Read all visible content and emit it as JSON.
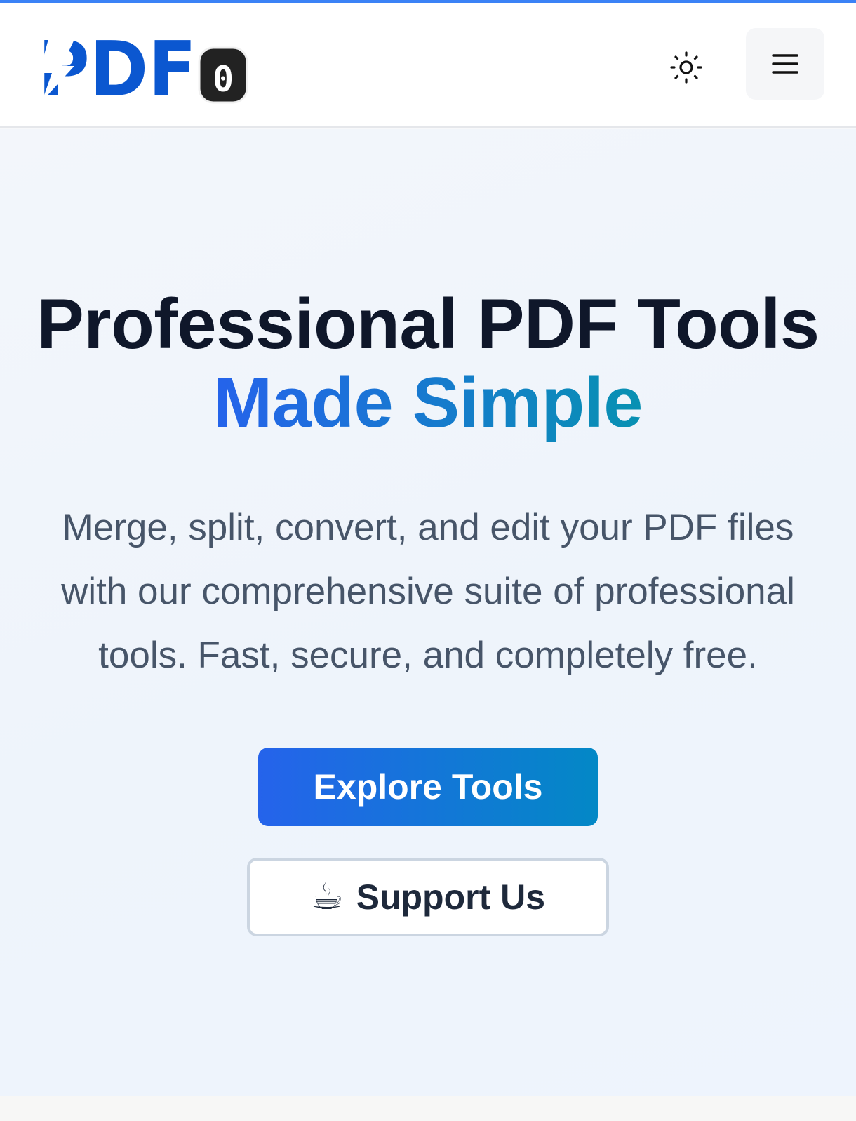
{
  "header": {
    "logo": {
      "text": "PDF",
      "badge": "0",
      "color": "#0b57d0"
    },
    "theme_toggle_icon": "sun-icon",
    "menu_icon": "hamburger-menu-icon"
  },
  "hero": {
    "title_line1": "Professional PDF Tools",
    "title_line2": "Made Simple",
    "description_lines": [
      "Merge, split, convert, and edit your PDF files",
      "with our comprehensive suite of professional",
      "tools. Fast, secure, and completely free."
    ],
    "primary_button": {
      "label": "Explore Tools"
    },
    "secondary_button": {
      "icon": "☕",
      "label": "Support Us"
    }
  },
  "colors": {
    "accent": "#3b82f6",
    "gradient_start": "#2563eb",
    "gradient_end": "#0891b2",
    "heading": "#0f172a",
    "body_text": "#475569"
  }
}
